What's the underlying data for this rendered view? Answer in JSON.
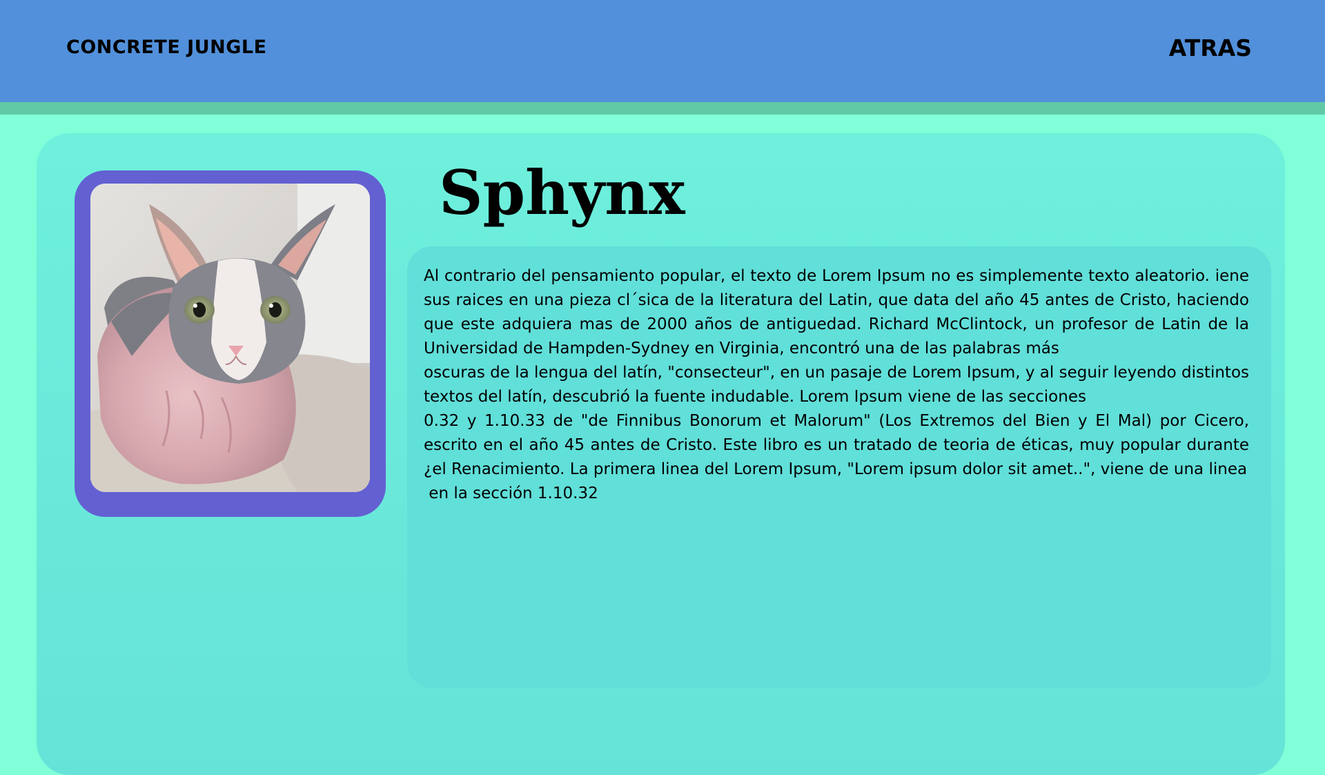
{
  "header": {
    "brand": "CONCRETE JUNGLE",
    "back_label": "ATRAS"
  },
  "breed": {
    "name": "Sphynx",
    "photo_alt": "Gato Sphynx",
    "description": [
      "Al contrario del pensamiento popular, el texto de Lorem Ipsum no es simplemente texto aleatorio. iene sus raices en una pieza cl´sica de la literatura del Latin, que data del año 45 antes de Cristo, haciendo que este adquiera mas de 2000 años de antiguedad. Richard McClintock, un profesor de Latin de la Universidad de Hampden-Sydney en Virginia, encontró una de las palabras más",
      "oscuras de la lengua del latín, \"consecteur\", en un pasaje de Lorem Ipsum, y al seguir leyendo distintos textos del latín, descubrió la fuente indudable. Lorem Ipsum viene de las secciones",
      "0.32 y 1.10.33 de \"de Finnibus Bonorum et Malorum\" (Los Extremos del Bien y El Mal) por Cicero, escrito en el año 45 antes de Cristo. Este libro es un tratado de teoria de éticas, muy popular durante ¿el Renacimiento. La primera linea del Lorem Ipsum, \"Lorem ipsum dolor sit amet..\", viene de una linea",
      " en la sección 1.10.32"
    ]
  },
  "colors": {
    "header": "#5290db",
    "stripe": "#62c9a6",
    "background": "#80ffd9",
    "card": "#6ef0dc",
    "panel": "#61dfd9",
    "frame": "#6360d2"
  }
}
